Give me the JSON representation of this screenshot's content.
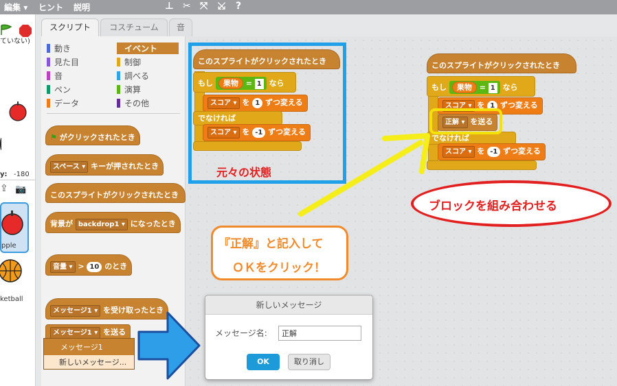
{
  "menubar": {
    "edit": "編集",
    "hint": "ヒント",
    "explain": "説明"
  },
  "stage": {
    "hidden_text": "ていない)",
    "y_label": "y:",
    "y_value": "-180",
    "sprite1": "pple",
    "sprite2": "ketball"
  },
  "tabs": [
    "スクリプト",
    "コスチューム",
    "音"
  ],
  "categories": {
    "left": [
      "動き",
      "見た目",
      "音",
      "ペン",
      "データ"
    ],
    "right": [
      "イベント",
      "制御",
      "調べる",
      "演算",
      "その他"
    ],
    "colors_left": [
      "#4a6cd4",
      "#8a55d7",
      "#bb42c3",
      "#0e9a6c",
      "#ee7d16"
    ],
    "colors_right": [
      "#c88330",
      "#e1a91a",
      "#2ca5e2",
      "#5cb712",
      "#632d99"
    ]
  },
  "palette": {
    "flag_clicked": "がクリックされたとき",
    "key_dd": "スペース",
    "key_pressed": "キーが押されたとき",
    "sprite_clicked": "このスプライトがクリックされたとき",
    "backdrop_pre": "背景が",
    "backdrop_dd": "backdrop1",
    "backdrop_post": "になったとき",
    "loudness_dd": "音量",
    "gt": ">",
    "loudness_num": "10",
    "loudness_post": "のとき",
    "msg_dd": "メッセージ1",
    "msg_received": "を受け取ったとき",
    "msg_send_dd": "メッセージ1",
    "msg_send": "を送る"
  },
  "dropdown_menu": {
    "item1": "メッセージ1",
    "item2": "新しいメッセージ..."
  },
  "script_left": {
    "hat": "このスプライトがクリックされたとき",
    "if": "もし",
    "then": "なら",
    "var": "果物",
    "eq": "=",
    "eq_val": "1",
    "score": "スコア",
    "wo": "を",
    "change": "ずつ変える",
    "val1": "1",
    "else": "でなければ",
    "val2": "-1"
  },
  "script_right": {
    "hat": "このスプライトがクリックされたとき",
    "if": "もし",
    "then": "なら",
    "var": "果物",
    "eq": "=",
    "eq_val": "1",
    "score": "スコア",
    "wo": "を",
    "change": "ずつ変える",
    "val1": "1",
    "broadcast_dd": "正解",
    "broadcast": "を送る",
    "else": "でなければ",
    "val2": "-1"
  },
  "annotations": {
    "original_state": "元々の状態",
    "instruction_line1": "『正解』と記入して",
    "instruction_line2": "ＯＫをクリック！",
    "combine": "ブロックを組み合わせる"
  },
  "dialog": {
    "title": "新しいメッセージ",
    "label": "メッセージ名:",
    "value": "正解",
    "ok": "OK",
    "cancel": "取り消し"
  }
}
